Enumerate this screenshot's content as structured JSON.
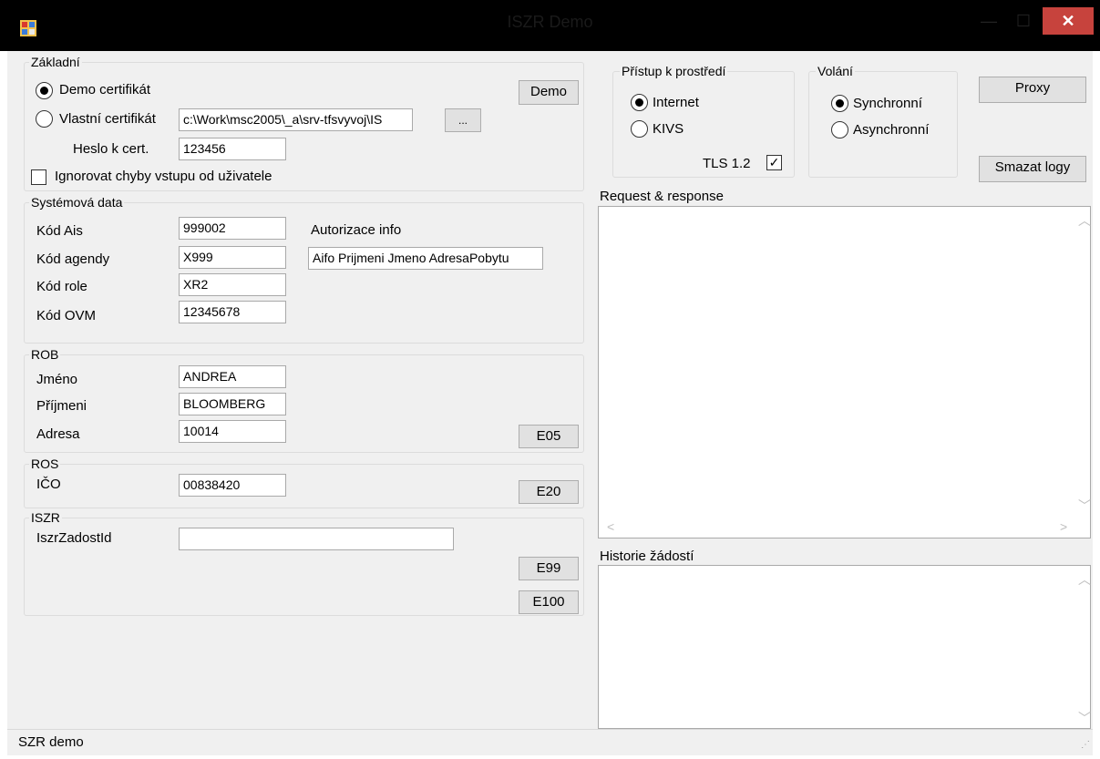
{
  "window": {
    "title": "ISZR Demo",
    "minimize": "—",
    "maximize": "☐",
    "close": "✕"
  },
  "basic": {
    "legend": "Základní",
    "demo_cert_label": "Demo certifikát",
    "own_cert_label": "Vlastní certifikát",
    "cert_path_value": "c:\\Work\\msc2005\\_a\\srv-tfsvyvoj\\IS",
    "browse_label": "...",
    "password_label": "Heslo k cert.",
    "password_value": "123456",
    "ignore_errors_label": "Ignorovat chyby vstupu od uživatele",
    "demo_button": "Demo"
  },
  "system": {
    "legend": "Systémová data",
    "ais_label": "Kód Ais",
    "ais_value": "999002",
    "agenda_label": "Kód agendy",
    "agenda_value": "X999",
    "role_label": "Kód role",
    "role_value": "XR2",
    "ovm_label": "Kód OVM",
    "ovm_value": "12345678",
    "auth_label": "Autorizace info",
    "auth_value": "Aifo Prijmeni Jmeno AdresaPobytu"
  },
  "rob": {
    "legend": "ROB",
    "first_label": "Jméno",
    "first_value": "ANDREA",
    "last_label": "Příjmeni",
    "last_value": "BLOOMBERG",
    "address_label": "Adresa",
    "address_value": "10014",
    "button": "E05"
  },
  "ros": {
    "legend": "ROS",
    "ico_label": "IČO",
    "ico_value": "00838420",
    "button": "E20"
  },
  "iszr": {
    "legend": "ISZR",
    "request_id_label": "IszrZadostId",
    "request_id_value": "",
    "e99_button": "E99",
    "e100_button": "E100"
  },
  "environment": {
    "legend": "Přístup k prostředí",
    "internet_label": "Internet",
    "kivs_label": "KIVS",
    "tls_label": "TLS 1.2"
  },
  "calling": {
    "legend": "Volání",
    "sync_label": "Synchronní",
    "async_label": "Asynchronní"
  },
  "toolbar": {
    "proxy_button": "Proxy",
    "clear_logs_button": "Smazat logy"
  },
  "request_response": {
    "label": "Request & response"
  },
  "history": {
    "label": "Historie žádostí"
  },
  "status": {
    "text": "SZR demo"
  },
  "colors": {
    "titlebar": "#000000",
    "close": "#c7433d",
    "client": "#f0f0f0"
  }
}
